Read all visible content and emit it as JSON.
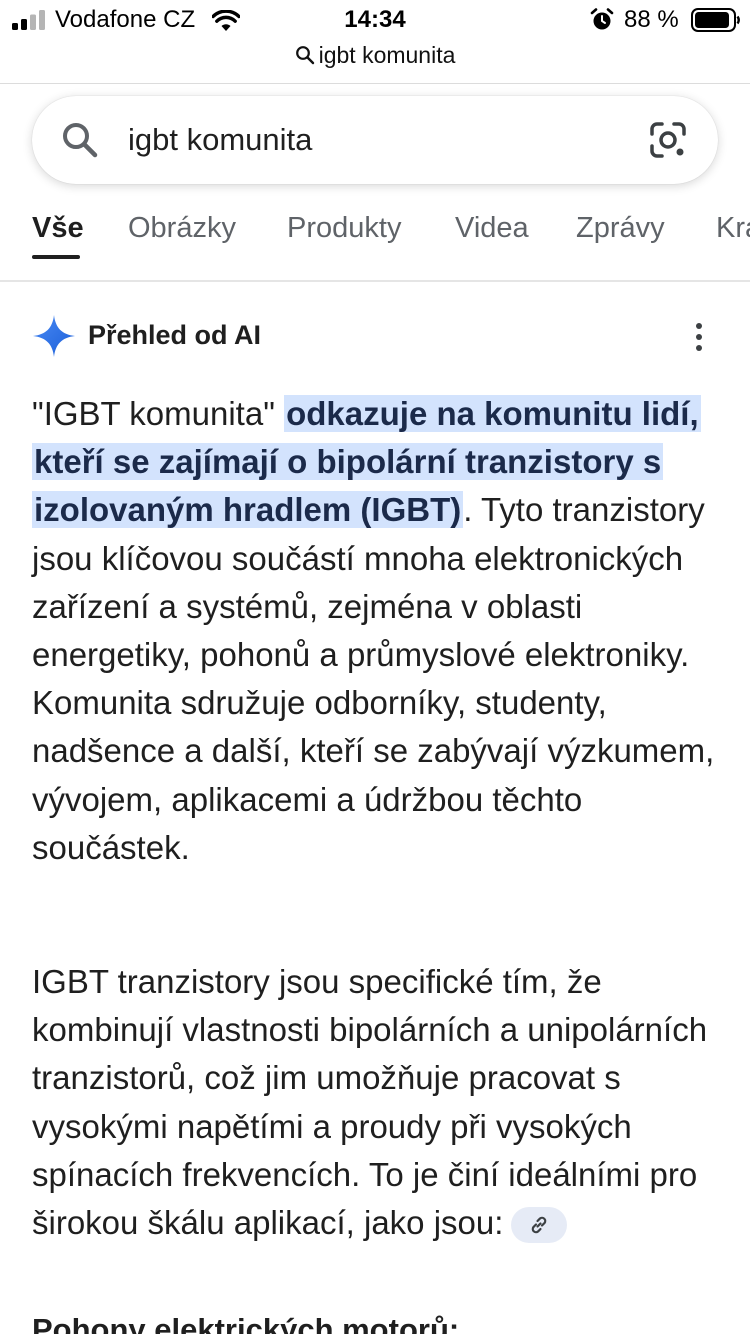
{
  "status_bar": {
    "carrier": "Vodafone CZ",
    "time": "14:34",
    "battery": "88 %",
    "icons": [
      "signal-icon",
      "wifi-icon",
      "alarm-icon",
      "battery-icon"
    ]
  },
  "url_bar": {
    "text": "igbt komunita",
    "icon": "search-icon"
  },
  "search": {
    "query": "igbt komunita",
    "left_icon": "search-icon",
    "right_icon": "lens-camera-icon"
  },
  "tabs": [
    {
      "label": "Vše",
      "active": true
    },
    {
      "label": "Obrázky",
      "active": false
    },
    {
      "label": "Produkty",
      "active": false
    },
    {
      "label": "Videa",
      "active": false
    },
    {
      "label": "Zprávy",
      "active": false
    },
    {
      "label": "Kra",
      "active": false
    }
  ],
  "ai_overview": {
    "title": "Přehled od AI",
    "icon": "sparkle-icon",
    "menu_icon": "more-vert-icon",
    "p1_prefix": "\"IGBT komunita\"",
    "p1_highlight": "odkazuje na komunitu lidí, kteří se zajímají o bipolární tranzistory s izolovaným hradlem (IGBT)",
    "p1_rest": ". Tyto tranzistory jsou klíčovou součástí mnoha elektronických zařízení a systémů, zejména v oblasti energetiky, pohonů a průmyslové elektroniky. Komunita sdružuje odborníky, studenty, nadšence a další, kteří se zabývají výzkumem, vývojem, aplikacemi a údržbou těchto součástek.",
    "p2_text": "IGBT tranzistory jsou specifické tím, že kombinují vlastnosti bipolárních a unipolárních tranzistorů, což jim umožňuje pracovat s vysokými napětími a proudy při vysokých spínacích frekvencích. To je činí ideálními pro širokou škálu aplikací, jako jsou:",
    "link_icon": "link-icon",
    "next_heading": "Pohony elektrických motorů:"
  },
  "colors": {
    "highlight": "#d3e3fd",
    "link_chip": "#e6ebf6",
    "tab_inactive": "#5f6368",
    "text": "#1f1f1f",
    "ai_spark": "#4285f4"
  }
}
